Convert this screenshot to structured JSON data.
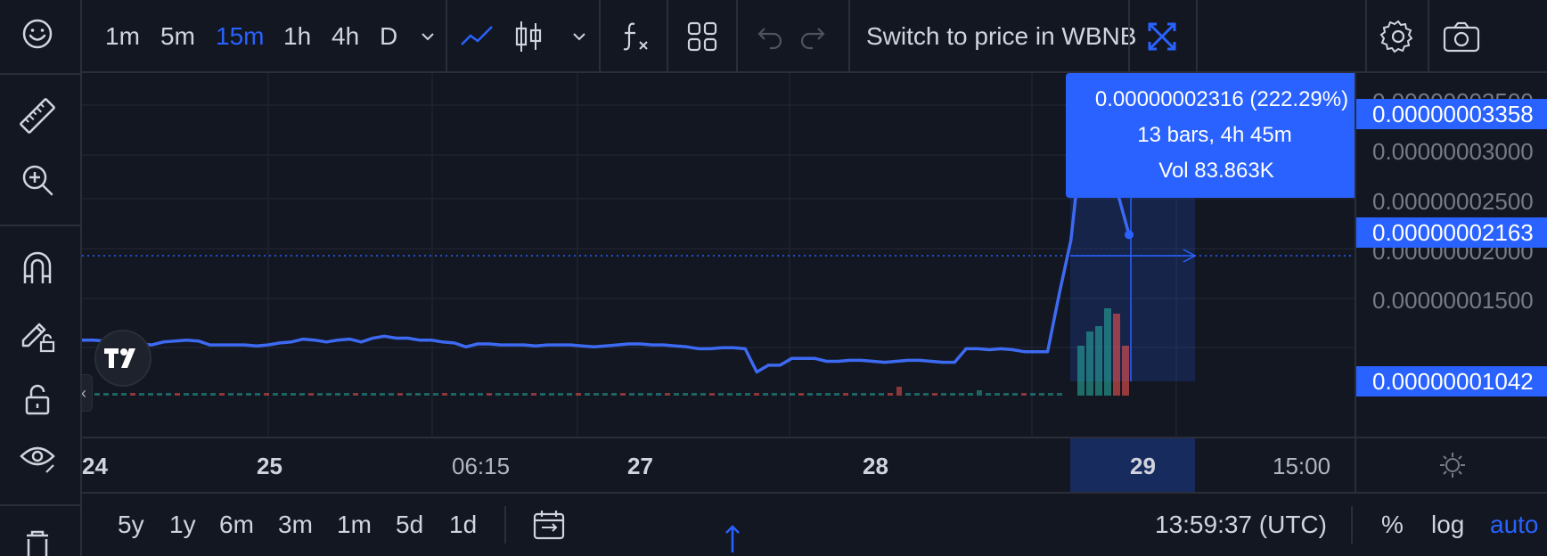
{
  "top_toolbar": {
    "intervals": [
      "1m",
      "5m",
      "15m",
      "1h",
      "4h",
      "D"
    ],
    "active_interval": "15m",
    "switch_price_label": "Switch to price in WBNB"
  },
  "tooltip": {
    "change": "0.00000002316 (222.29%)",
    "bars": "13 bars, 4h 45m",
    "volume": "Vol 83.863K"
  },
  "price_axis": {
    "labels": [
      "0.00000003500",
      "0.00000003000",
      "0.00000002500",
      "0.00000002000",
      "0.00000001500"
    ],
    "highlighted": [
      "0.00000003358",
      "0.00000002163",
      "0.00000001042"
    ]
  },
  "time_axis": {
    "labels": [
      "24",
      "25",
      "06:15",
      "27",
      "28",
      "29",
      "15:00"
    ]
  },
  "bottom_toolbar": {
    "ranges": [
      "5y",
      "1y",
      "6m",
      "3m",
      "1m",
      "5d",
      "1d"
    ],
    "clock": "13:59:37 (UTC)",
    "percent_label": "%",
    "log_label": "log",
    "auto_label": "auto"
  },
  "colors": {
    "background": "#131722",
    "accent": "#2962ff",
    "line": "#3d6af2",
    "volume_up": "#26a69a",
    "volume_down": "#ef5350"
  },
  "chart_data": {
    "type": "line",
    "y_axis_range": [
      1.07e-08,
      3.67e-08
    ],
    "last_price": 2.163e-08,
    "selection_high": 3.358e-08,
    "selection_low": 1.042e-08,
    "series": [
      {
        "values": [
          1.07,
          1.07,
          1.06,
          1.08,
          1.08,
          1.03,
          1.02,
          1.05,
          1.06,
          1.07,
          1.06,
          1.02,
          1.02,
          1.02,
          1.02,
          1.01,
          1.02,
          1.04,
          1.05,
          1.08,
          1.07,
          1.05,
          1.07,
          1.08,
          1.05,
          1.09,
          1.11,
          1.09,
          1.09,
          1.07,
          1.07,
          1.05,
          1.04,
          1.0,
          1.03,
          1.03,
          1.02,
          1.02,
          1.02,
          1.01,
          1.02,
          1.02,
          1.02,
          1.01,
          1.0,
          1.01,
          1.02,
          1.03,
          1.03,
          1.02,
          1.02,
          1.01,
          1.0,
          0.98,
          0.98,
          0.99,
          0.99,
          0.98,
          0.74,
          0.81,
          0.81,
          0.88,
          0.88,
          0.88,
          0.85,
          0.85,
          0.86,
          0.86,
          0.85,
          0.84,
          0.85,
          0.86,
          0.86,
          0.85,
          0.84,
          0.84,
          0.98,
          0.98,
          0.97,
          0.98,
          0.97,
          0.95,
          0.95,
          0.95,
          1.55,
          2.1,
          3.2,
          3.7,
          3.5,
          2.6,
          2.16
        ]
      }
    ]
  }
}
